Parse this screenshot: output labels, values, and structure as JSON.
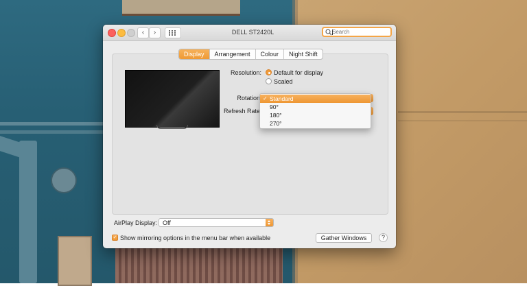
{
  "window": {
    "title": "DELL ST2420L",
    "search_placeholder": "Search",
    "back_glyph": "‹",
    "forward_glyph": "›"
  },
  "tabs": [
    {
      "label": "Display",
      "active": true
    },
    {
      "label": "Arrangement",
      "active": false
    },
    {
      "label": "Colour",
      "active": false
    },
    {
      "label": "Night Shift",
      "active": false
    }
  ],
  "resolution": {
    "label": "Resolution:",
    "options": [
      {
        "label": "Default for display",
        "selected": true
      },
      {
        "label": "Scaled",
        "selected": false
      }
    ]
  },
  "rotation": {
    "label": "Rotation",
    "menu_items": [
      {
        "label": "Standard",
        "selected": true
      },
      {
        "label": "90°",
        "selected": false
      },
      {
        "label": "180°",
        "selected": false
      },
      {
        "label": "270°",
        "selected": false
      }
    ],
    "check_glyph": "✓"
  },
  "refresh_rate": {
    "label": "Refresh Rate"
  },
  "airplay": {
    "label": "AirPlay Display:",
    "value": "Off"
  },
  "mirroring": {
    "label": "Show mirroring options in the menu bar when available",
    "checked": true,
    "check_glyph": "✓"
  },
  "buttons": {
    "gather": "Gather Windows",
    "help": "?"
  },
  "colors": {
    "accent": "#ef9a34",
    "close": "#fc605c",
    "minimize": "#fdbc40"
  }
}
